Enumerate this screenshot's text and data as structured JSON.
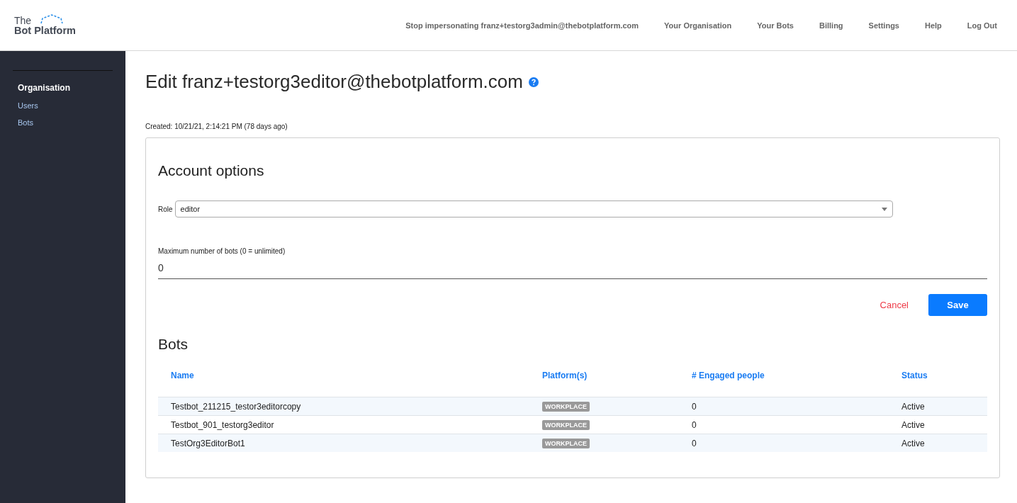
{
  "header": {
    "logo": {
      "line1": "The",
      "line2": "Bot Platform"
    },
    "nav": [
      "Stop impersonating franz+testorg3admin@thebotplatform.com",
      "Your Organisation",
      "Your Bots",
      "Billing",
      "Settings",
      "Help",
      "Log Out"
    ]
  },
  "sidebar": {
    "items": [
      {
        "label": "Organisation",
        "selected": true
      },
      {
        "label": "Users",
        "selected": false
      },
      {
        "label": "Bots",
        "selected": false
      }
    ]
  },
  "page": {
    "title": "Edit franz+testorg3editor@thebotplatform.com",
    "created": "Created: 10/21/21, 2:14:21 PM (78 days ago)"
  },
  "account_options": {
    "heading": "Account options",
    "role": {
      "label": "Role",
      "value": "editor"
    },
    "max_bots": {
      "label": "Maximum number of bots (0 = unlimited)",
      "value": "0"
    },
    "buttons": {
      "cancel": "Cancel",
      "save": "Save"
    }
  },
  "bots": {
    "heading": "Bots",
    "columns": [
      "Name",
      "Platform(s)",
      "# Engaged people",
      "Status"
    ],
    "rows": [
      {
        "name": "Testbot_211215_testor3editorcopy",
        "platform": "WORKPLACE",
        "engaged": "0",
        "status": "Active"
      },
      {
        "name": "Testbot_901_testorg3editor",
        "platform": "WORKPLACE",
        "engaged": "0",
        "status": "Active"
      },
      {
        "name": "TestOrg3EditorBot1",
        "platform": "WORKPLACE",
        "engaged": "0",
        "status": "Active"
      }
    ]
  }
}
